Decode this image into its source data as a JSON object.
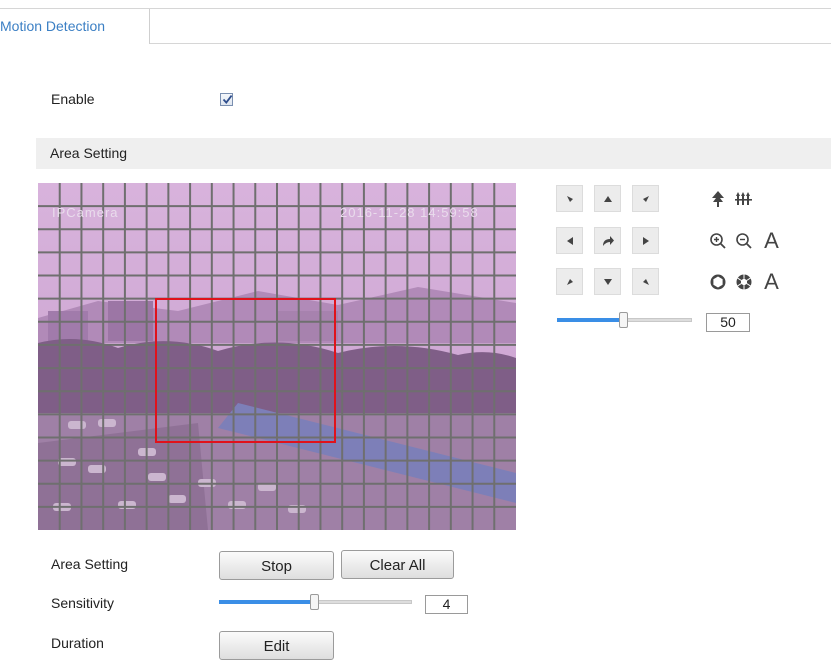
{
  "tabs": [
    {
      "label": "Motion Detection",
      "active": true
    }
  ],
  "enable": {
    "label": "Enable",
    "checked": true
  },
  "section_title": "Area Setting",
  "video": {
    "osd_left": "IPCamera",
    "osd_right": "2016-11-28 14:59:58",
    "grid_columns": 22,
    "grid_rows": 15,
    "selection_color": "#e0121b",
    "overlay_color": "#c9a3cf"
  },
  "ptz": {
    "icons": [
      "pan-up-left-icon",
      "pan-up-icon",
      "pan-up-right-icon",
      "pan-left-icon",
      "auto-rotate-icon",
      "pan-right-icon",
      "pan-down-left-icon",
      "pan-down-icon",
      "pan-down-right-icon",
      "focus-near-icon",
      "focus-far-icon",
      "zoom-in-icon",
      "zoom-out-icon",
      "auto-focus-icon",
      "iris-open-icon",
      "iris-close-icon",
      "auto-iris-icon"
    ],
    "auto_focus_label": "A",
    "auto_iris_label": "A",
    "speed": {
      "value": "50",
      "fraction": 0.49
    }
  },
  "area_setting": {
    "label": "Area Setting",
    "stop_label": "Stop",
    "clear_label": "Clear All"
  },
  "sensitivity": {
    "label": "Sensitivity",
    "value": "4",
    "fraction": 0.49
  },
  "duration": {
    "label": "Duration",
    "edit_label": "Edit"
  },
  "colors": {
    "tab_active_text": "#3b7fc4",
    "slider_fill": "#3a8ee6",
    "section_bg": "#efefef"
  }
}
